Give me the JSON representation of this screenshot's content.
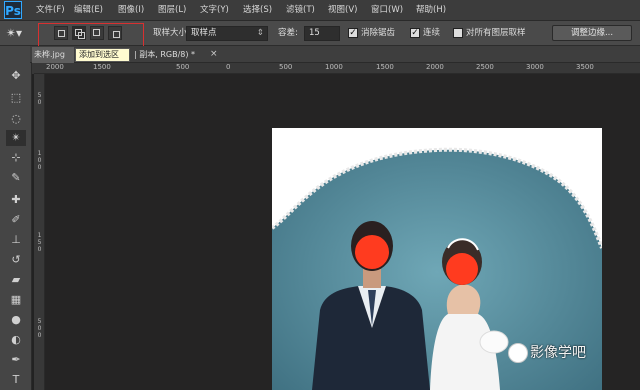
{
  "app": {
    "logo": "Ps"
  },
  "menu": [
    "文件(F)",
    "编辑(E)",
    "图像(I)",
    "图层(L)",
    "文字(Y)",
    "选择(S)",
    "滤镜(T)",
    "视图(V)",
    "窗口(W)",
    "帮助(H)"
  ],
  "options": {
    "sample_size_label": "取样大小:",
    "sample_size_value": "取样点",
    "tolerance_label": "容差:",
    "tolerance_value": "15",
    "antialias_label": "消除锯齿",
    "contiguous_label": "连续",
    "all_layers_label": "对所有图层取样",
    "refine_edge_label": "调整边缘..."
  },
  "tabs": {
    "doc_tab_label": "未桦.jpg",
    "doc_tab2_label": "| 副本, RGB/8) *",
    "close_glyph": "×"
  },
  "tooltip": "添加到选区",
  "ruler": {
    "h_ticks": [
      "2000",
      "1500",
      "500",
      "0",
      "500",
      "1000",
      "1500",
      "2000",
      "2500",
      "3000",
      "3500"
    ],
    "v_ticks": [
      "5 0",
      "1 0 0",
      "1 5 0",
      "5 0 0"
    ]
  },
  "watermark": "影像学吧",
  "colors": {
    "accent": "#31a8ff",
    "selection_highlight": "#d83030",
    "face_blur": "#ff3b1f"
  }
}
